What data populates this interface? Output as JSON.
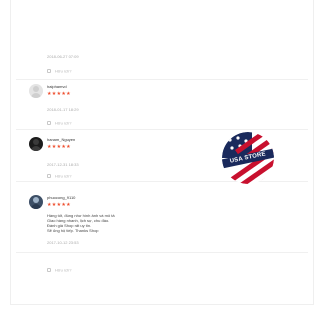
{
  "reviews": [
    {
      "date": "2018-06-27 07:09",
      "helpful_label": "Hữu ích?"
    },
    {
      "username": "haiphamvd",
      "stars": "★★★★★",
      "date": "2018-01-17 18:29",
      "helpful_label": "Hữu ích?"
    },
    {
      "username": "hanam_Nguyen",
      "stars": "★★★★★",
      "date": "2017-12-31 18:33",
      "helpful_label": "Hữu ích?"
    },
    {
      "username": "phuocong_9110",
      "stars": "★★★★★",
      "comment_lines": [
        "Hàng tốt, đúng như hình ảnh và mô tả",
        "Giao hàng nhanh, lịch sự, chu đáo.",
        "Đánh giá Shop rất uy tín.",
        "Sẽ ủng hộ tiếp. Thanks Shop"
      ],
      "date": "2017-10-12 23:53",
      "helpful_label": "Hữu ích?"
    }
  ],
  "badge": {
    "text": "USA STORE",
    "colors": {
      "navy": "#1a2a5c",
      "red": "#c8102e",
      "white": "#ffffff"
    }
  },
  "accent": {
    "stars": "#ee4d2d"
  }
}
